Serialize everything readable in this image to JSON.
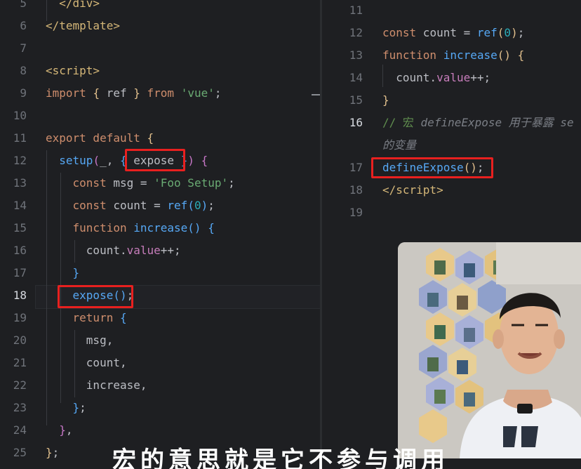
{
  "left_editor": {
    "lines": [
      {
        "n": "5",
        "html": "  <span class=\"tag\">&lt;/div&gt;</span>"
      },
      {
        "n": "6",
        "html": "<span class=\"tag\">&lt;/template&gt;</span>"
      },
      {
        "n": "7",
        "html": ""
      },
      {
        "n": "8",
        "html": "<span class=\"tag\">&lt;script&gt;</span>"
      },
      {
        "n": "9",
        "html": "<span class=\"kw\">import</span> <span class=\"br1\">{</span> ref <span class=\"br1\">}</span> <span class=\"kw\">from</span> <span class=\"str\">'vue'</span>;"
      },
      {
        "n": "10",
        "html": ""
      },
      {
        "n": "11",
        "html": "<span class=\"kw\">export default</span> <span class=\"br1\">{</span>"
      },
      {
        "n": "12",
        "html": "  <span class=\"fn\">setup</span><span class=\"br2\">(</span>_, <span class=\"br3\">{</span> expose <span class=\"br3\">}</span><span class=\"br2\">)</span> <span class=\"br2\">{</span>"
      },
      {
        "n": "13",
        "html": "    <span class=\"kw\">const</span> msg = <span class=\"str\">'Foo Setup'</span>;"
      },
      {
        "n": "14",
        "html": "    <span class=\"kw\">const</span> count = <span class=\"fn\">ref</span><span class=\"br3\">(</span><span class=\"num\">0</span><span class=\"br3\">)</span>;"
      },
      {
        "n": "15",
        "html": "    <span class=\"kw\">function</span> <span class=\"fn\">increase</span><span class=\"br3\">()</span> <span class=\"br3\">{</span>"
      },
      {
        "n": "16",
        "html": "      count.<span class=\"var\">value</span>++;"
      },
      {
        "n": "17",
        "html": "    <span class=\"br3\">}</span>"
      },
      {
        "n": "18",
        "html": "    <span class=\"fn\">expose</span><span class=\"br3\">()</span>;",
        "current": true
      },
      {
        "n": "19",
        "html": "    <span class=\"kw\">return</span> <span class=\"br3\">{</span>"
      },
      {
        "n": "20",
        "html": "      msg,"
      },
      {
        "n": "21",
        "html": "      count,"
      },
      {
        "n": "22",
        "html": "      increase,"
      },
      {
        "n": "23",
        "html": "    <span class=\"br3\">}</span>;"
      },
      {
        "n": "24",
        "html": "  <span class=\"br2\">}</span>,"
      },
      {
        "n": "25",
        "html": "<span class=\"br1\">}</span>;"
      }
    ]
  },
  "right_editor": {
    "lines": [
      {
        "n": "11",
        "html": ""
      },
      {
        "n": "12",
        "html": "<span class=\"kw\">const</span> count = <span class=\"fn\">ref</span><span class=\"br1\">(</span><span class=\"num\">0</span><span class=\"br1\">)</span>;"
      },
      {
        "n": "13",
        "html": "<span class=\"kw\">function</span> <span class=\"fn\">increase</span><span class=\"br1\">()</span> <span class=\"br1\">{</span>"
      },
      {
        "n": "14",
        "html": "  count.<span class=\"var\">value</span>++;"
      },
      {
        "n": "15",
        "html": "<span class=\"br1\">}</span>"
      },
      {
        "n": "16",
        "html": "<span class=\"cmt-cn\">// 宏</span> <span class=\"cmt\">defineExpose 用于暴露 se</span>",
        "current": true
      },
      {
        "n": "",
        "html": "<span class=\"cmt\">的变量</span>"
      },
      {
        "n": "17",
        "html": "<span class=\"fn\">defineExpose</span><span class=\"br1\">()</span>;"
      },
      {
        "n": "18",
        "html": "<span class=\"tag\">&lt;/script&gt;</span>"
      },
      {
        "n": "19",
        "html": ""
      }
    ]
  },
  "subtitle": "宏的意思就是它不参与调用",
  "colors": {
    "highlight": "#e8201f",
    "background": "#1e1f22"
  }
}
